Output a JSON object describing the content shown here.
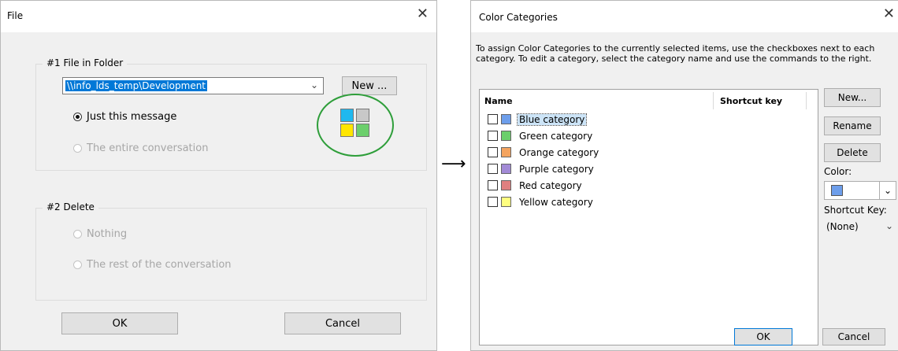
{
  "file_dialog": {
    "title": "File",
    "group1": {
      "legend": "#1  File in Folder",
      "folder_value": "\\\\info_lds_temp\\Development",
      "new_button": "New ...",
      "radio_just_this": "Just this message",
      "radio_entire": "The entire conversation"
    },
    "group2": {
      "legend": "#2  Delete",
      "radio_nothing": "Nothing",
      "radio_rest": "The rest of the conversation"
    },
    "ok_button": "OK",
    "cancel_button": "Cancel"
  },
  "color_dialog": {
    "title": "Color Categories",
    "instructions": "To assign Color Categories to the currently selected items, use the checkboxes next to each category.  To edit a category, select the category name and use the commands to the right.",
    "columns": [
      "Name",
      "Shortcut key"
    ],
    "categories": [
      {
        "label": "Blue category",
        "color": "#6d9eeb",
        "selected": true
      },
      {
        "label": "Green category",
        "color": "#6ccf6c"
      },
      {
        "label": "Orange category",
        "color": "#f4a460"
      },
      {
        "label": "Purple category",
        "color": "#a28ad6"
      },
      {
        "label": "Red category",
        "color": "#e08080"
      },
      {
        "label": "Yellow category",
        "color": "#ffff80"
      }
    ],
    "new_button": "New...",
    "rename_button": "Rename",
    "delete_button": "Delete",
    "color_label": "Color:",
    "shortcut_label": "Shortcut Key:",
    "shortcut_value": "(None)",
    "ok_button": "OK",
    "cancel_button": "Cancel"
  },
  "arrow": "⟶",
  "colors": {
    "highlight": "#0078d7",
    "circle": "#2e9e3a",
    "icon_cyan": "#1fb8ef",
    "icon_gray": "#c8c8c8",
    "icon_yellow": "#ffe600",
    "icon_green": "#6ccf6c"
  }
}
